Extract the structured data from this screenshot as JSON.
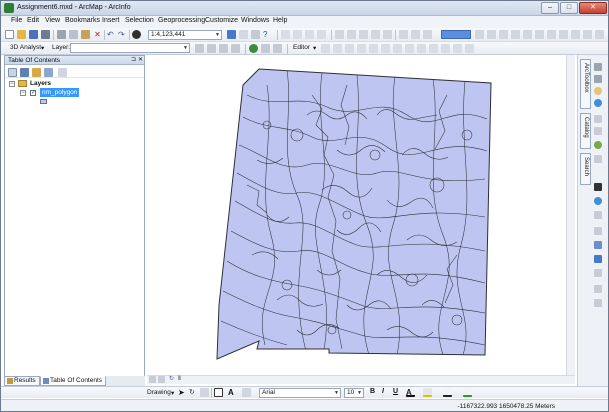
{
  "window": {
    "title": "Assignment6.mxd - ArcMap - ArcInfo"
  },
  "menu": [
    "File",
    "Edit",
    "View",
    "Bookmarks",
    "Insert",
    "Selection",
    "Geoprocessing",
    "Customize",
    "Windows",
    "Help"
  ],
  "toolbar": {
    "scale_value": "1:4,123,441"
  },
  "toolbar2": {
    "analyst_label": "3D Analyst",
    "layer_label": "Layer:",
    "editor_label": "Editor"
  },
  "toc": {
    "title": "Table Of Contents",
    "group_label": "Layers",
    "layer_name": "nm_polygon"
  },
  "tabs": {
    "results": "Results",
    "toc": "Table Of Contents"
  },
  "right_dock": {
    "arctoolbox": "ArcToolbox",
    "catalog": "Catalog",
    "search": "Search"
  },
  "drawing": {
    "label": "Drawing",
    "font_name": "Arial",
    "font_size": "10",
    "bold": "B",
    "italic": "I",
    "underline": "U"
  },
  "status": {
    "coordinates": "-1167322.993  1650478.25 Meters"
  },
  "colors": {
    "polygon_fill": "#bec5f0",
    "polygon_stroke": "#2d2f3a",
    "selection": "#3399ff"
  }
}
